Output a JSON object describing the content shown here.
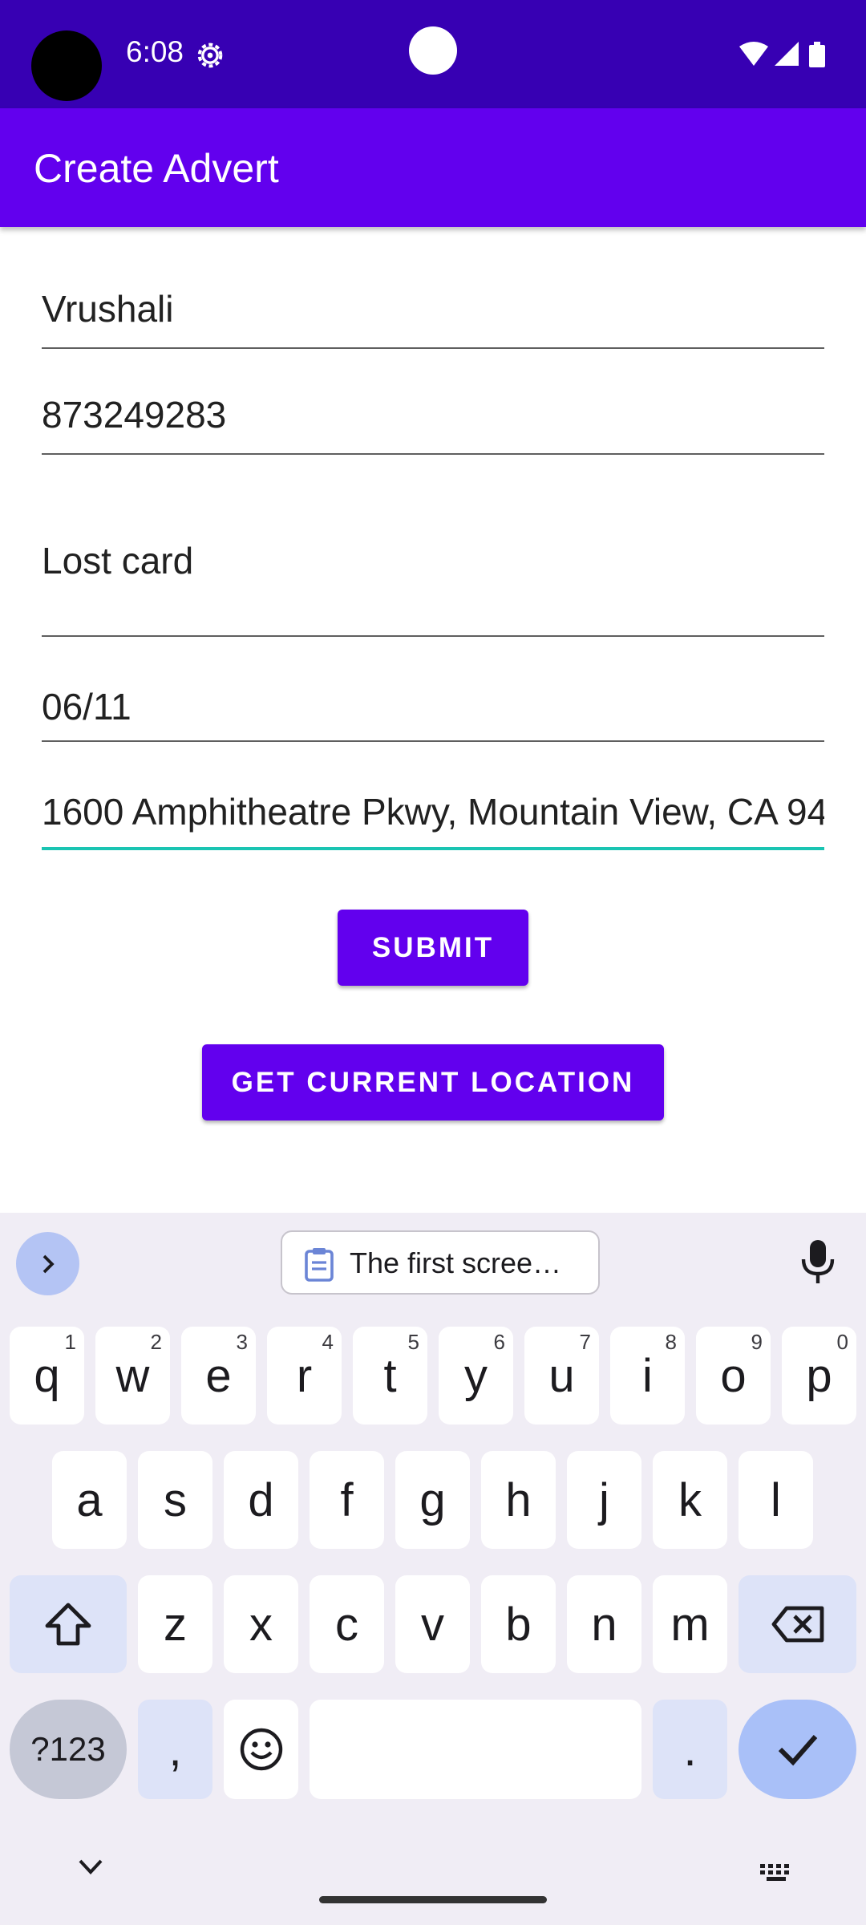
{
  "status_bar": {
    "time": "6:08"
  },
  "app_bar": {
    "title": "Create Advert"
  },
  "form": {
    "name_value": "Vrushali",
    "phone_value": "873249283",
    "description_value": "Lost card",
    "date_value": "06/11",
    "location_value": "1600 Amphitheatre Pkwy, Mountain View, CA 94"
  },
  "buttons": {
    "submit_label": "SUBMIT",
    "location_label": "GET CURRENT LOCATION"
  },
  "keyboard": {
    "clipboard_text": "The first scree…",
    "row1": [
      {
        "k": "q",
        "h": "1"
      },
      {
        "k": "w",
        "h": "2"
      },
      {
        "k": "e",
        "h": "3"
      },
      {
        "k": "r",
        "h": "4"
      },
      {
        "k": "t",
        "h": "5"
      },
      {
        "k": "y",
        "h": "6"
      },
      {
        "k": "u",
        "h": "7"
      },
      {
        "k": "i",
        "h": "8"
      },
      {
        "k": "o",
        "h": "9"
      },
      {
        "k": "p",
        "h": "0"
      }
    ],
    "row2": [
      "a",
      "s",
      "d",
      "f",
      "g",
      "h",
      "j",
      "k",
      "l"
    ],
    "row3": [
      "z",
      "x",
      "c",
      "v",
      "b",
      "n",
      "m"
    ],
    "symbols_label": "?123",
    "comma_label": ",",
    "period_label": ".",
    "accent_color": "#6200ee",
    "focus_color": "#1ac4b2"
  }
}
